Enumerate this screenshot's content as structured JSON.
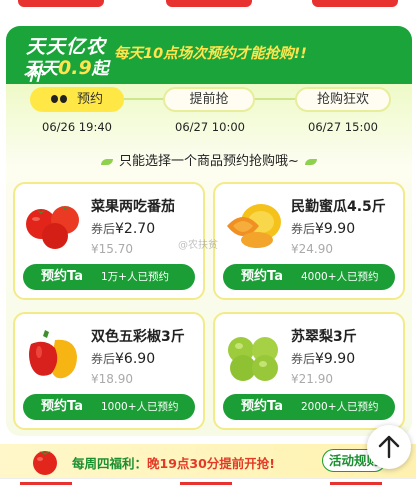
{
  "banner": {
    "logo_line1": "天天亿农补",
    "logo_line2_prefix": "天天",
    "logo_line2_price": "0.9",
    "logo_line2_suffix": "起",
    "slogan": "每天10点场次预约才能抢购!!"
  },
  "tabs": [
    {
      "label": "预约",
      "time": "06/26 19:40",
      "active": true
    },
    {
      "label": "提前抢",
      "time": "06/27 10:00",
      "active": false
    },
    {
      "label": "抢购狂欢",
      "time": "06/27 15:00",
      "active": false
    }
  ],
  "notice": "只能选择一个商品预约抢购哦~",
  "products": [
    {
      "name": "菜果两吃番茄",
      "price_label": "券后",
      "price": "¥2.70",
      "original": "¥15.70",
      "button": "预约Ta",
      "count": "1万+人已预约"
    },
    {
      "name": "民勤蜜瓜4.5斤",
      "price_label": "券后",
      "price": "¥9.90",
      "original": "¥24.90",
      "button": "预约Ta",
      "count": "4000+人已预约"
    },
    {
      "name": "双色五彩椒3斤",
      "price_label": "券后",
      "price": "¥6.90",
      "original": "¥18.90",
      "button": "预约Ta",
      "count": "1000+人已预约"
    },
    {
      "name": "苏翠梨3斤",
      "price_label": "券后",
      "price": "¥9.90",
      "original": "¥21.90",
      "button": "预约Ta",
      "count": "2000+人已预约"
    }
  ],
  "watermark": "@农扶贫",
  "footer": {
    "text_prefix": "每周四福利：",
    "text_highlight": "晚19点30分提前开抢!",
    "rules_label": "活动规则"
  },
  "colors": {
    "green": "#1aa43a",
    "yellow": "#ffe845",
    "red": "#e8322f"
  },
  "icons": [
    "tomato-icon",
    "melon-icon",
    "pepper-icon",
    "pear-icon",
    "arrow-up-icon",
    "eyes-icon"
  ]
}
